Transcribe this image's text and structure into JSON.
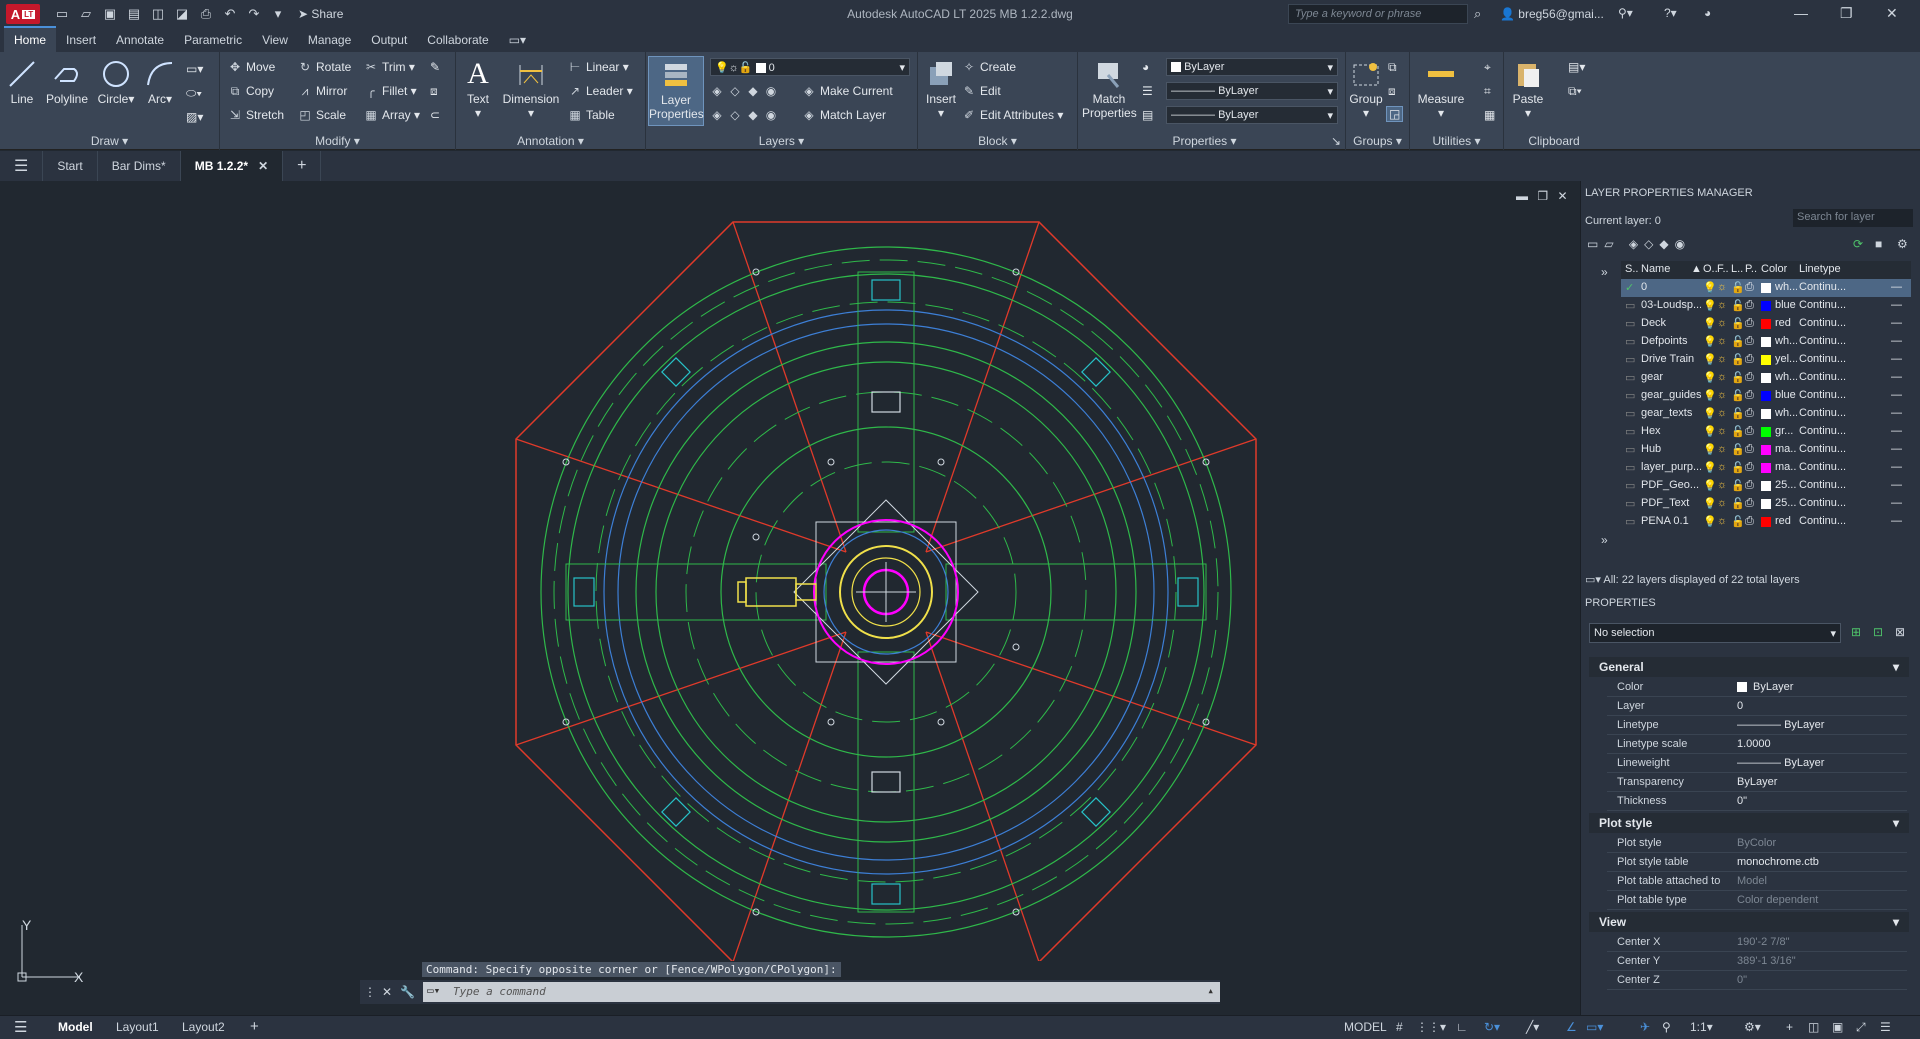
{
  "app": {
    "logo": "A",
    "logo_badge": "LT",
    "title": "Autodesk AutoCAD LT 2025    MB 1.2.2.dwg",
    "share": "Share",
    "search_placeholder": "Type a keyword or phrase",
    "user": "breg56@gmai..."
  },
  "ribbon_tabs": [
    "Home",
    "Insert",
    "Annotate",
    "Parametric",
    "View",
    "Manage",
    "Output",
    "Collaborate"
  ],
  "draw": {
    "title": "Draw",
    "line": "Line",
    "polyline": "Polyline",
    "circle": "Circle",
    "arc": "Arc"
  },
  "modify": {
    "title": "Modify",
    "move": "Move",
    "rotate": "Rotate",
    "trim": "Trim",
    "copy": "Copy",
    "mirror": "Mirror",
    "fillet": "Fillet",
    "stretch": "Stretch",
    "scale": "Scale",
    "array": "Array"
  },
  "annotation": {
    "title": "Annotation",
    "text": "Text",
    "dimension": "Dimension",
    "linear": "Linear",
    "leader": "Leader",
    "table": "Table"
  },
  "layers": {
    "title": "Layers",
    "layer_properties": "Layer Properties",
    "current_layer_value": "0",
    "make_current": "Make Current",
    "match_layer": "Match Layer"
  },
  "block": {
    "title": "Block",
    "insert": "Insert",
    "create": "Create",
    "edit": "Edit",
    "edit_attributes": "Edit Attributes"
  },
  "properties_panel": {
    "title": "Properties",
    "match_properties": "Match Properties",
    "color": "ByLayer",
    "linetype": "ByLayer",
    "lineweight": "ByLayer"
  },
  "groups": {
    "title": "Groups",
    "group": "Group"
  },
  "utilities": {
    "title": "Utilities",
    "measure": "Measure"
  },
  "clipboard": {
    "title": "Clipboard",
    "paste": "Paste"
  },
  "doc_tabs": {
    "start": "Start",
    "bar_dims": "Bar Dims*",
    "current": "MB 1.2.2*"
  },
  "layer_manager": {
    "title": "LAYER PROPERTIES MANAGER",
    "current_layer": "Current layer: 0",
    "search_placeholder": "Search for layer",
    "columns": {
      "status": "S..",
      "name": "Name",
      "on": "O..",
      "freeze": "F..",
      "lock": "L..",
      "plot": "P..",
      "color": "Color",
      "linetype": "Linetype"
    },
    "layers": [
      {
        "name": "0",
        "color_name": "wh...",
        "color": "#ffffff",
        "linetype": "Continu..."
      },
      {
        "name": "03-Loudsp...",
        "color_name": "blue",
        "color": "#0000ff",
        "linetype": "Continu..."
      },
      {
        "name": "Deck",
        "color_name": "red",
        "color": "#ff0000",
        "linetype": "Continu..."
      },
      {
        "name": "Defpoints",
        "color_name": "wh...",
        "color": "#ffffff",
        "linetype": "Continu..."
      },
      {
        "name": "Drive Train",
        "color_name": "yel...",
        "color": "#ffff00",
        "linetype": "Continu..."
      },
      {
        "name": "gear",
        "color_name": "wh...",
        "color": "#ffffff",
        "linetype": "Continu..."
      },
      {
        "name": "gear_guides",
        "color_name": "blue",
        "color": "#0000ff",
        "linetype": "Continu..."
      },
      {
        "name": "gear_texts",
        "color_name": "wh...",
        "color": "#ffffff",
        "linetype": "Continu..."
      },
      {
        "name": "Hex",
        "color_name": "gr...",
        "color": "#00ff00",
        "linetype": "Continu..."
      },
      {
        "name": "Hub",
        "color_name": "ma...",
        "color": "#ff00ff",
        "linetype": "Continu..."
      },
      {
        "name": "layer_purp...",
        "color_name": "ma...",
        "color": "#ff00ff",
        "linetype": "Continu..."
      },
      {
        "name": "PDF_Geo...",
        "color_name": "25...",
        "color": "#ffffff",
        "linetype": "Continu..."
      },
      {
        "name": "PDF_Text",
        "color_name": "25...",
        "color": "#ffffff",
        "linetype": "Continu..."
      },
      {
        "name": "PENA 0.1",
        "color_name": "red",
        "color": "#ff0000",
        "linetype": "Continu..."
      }
    ],
    "footer": "All: 22 layers displayed of 22 total layers"
  },
  "properties": {
    "title": "PROPERTIES",
    "selection": "No selection",
    "general": {
      "title": "General",
      "rows": [
        {
          "k": "Color",
          "v": "ByLayer"
        },
        {
          "k": "Layer",
          "v": "0"
        },
        {
          "k": "Linetype",
          "v": "ByLayer"
        },
        {
          "k": "Linetype scale",
          "v": "1.0000"
        },
        {
          "k": "Lineweight",
          "v": "ByLayer"
        },
        {
          "k": "Transparency",
          "v": "ByLayer"
        },
        {
          "k": "Thickness",
          "v": "0\""
        }
      ]
    },
    "plot_style": {
      "title": "Plot style",
      "rows": [
        {
          "k": "Plot style",
          "v": "ByColor"
        },
        {
          "k": "Plot style table",
          "v": "monochrome.ctb"
        },
        {
          "k": "Plot table attached to",
          "v": "Model"
        },
        {
          "k": "Plot table type",
          "v": "Color dependent"
        }
      ]
    },
    "view": {
      "title": "View",
      "rows": [
        {
          "k": "Center X",
          "v": "190'-2 7/8\""
        },
        {
          "k": "Center Y",
          "v": "389'-1 3/16\""
        },
        {
          "k": "Center Z",
          "v": "0\""
        }
      ]
    }
  },
  "command": {
    "history": "Command: Specify opposite corner or [Fence/WPolygon/CPolygon]:",
    "placeholder": "Type a command"
  },
  "ucs": {
    "x": "X",
    "y": "Y"
  },
  "layout_tabs": {
    "model": "Model",
    "layout1": "Layout1",
    "layout2": "Layout2"
  },
  "status": {
    "mode": "MODEL",
    "scale": "1:1"
  }
}
